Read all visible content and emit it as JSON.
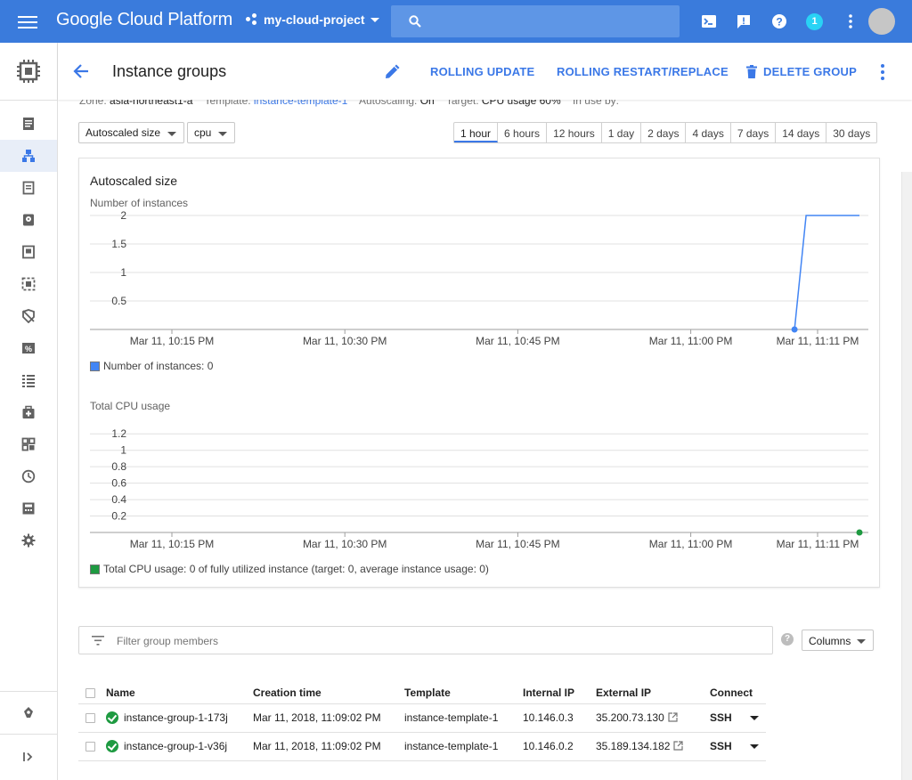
{
  "topbar": {
    "brand": "Google Cloud Platform",
    "project": "my-cloud-project",
    "notification_count": "1",
    "icons": [
      "menu-icon",
      "search-icon",
      "cloud-shell-icon",
      "feedback-icon",
      "help-icon",
      "more-vert-icon"
    ]
  },
  "sidenav": {
    "icons": [
      "compute-engine-icon",
      "vm-instances-icon",
      "instance-groups-icon",
      "instance-templates-icon",
      "disks-icon",
      "snapshots-icon",
      "images-icon",
      "tpus-icon",
      "committed-use-icon",
      "metadata-icon",
      "health-checks-icon",
      "zones-icon",
      "operations-icon",
      "security-scans-icon",
      "settings-icon",
      "marketplace-icon",
      "collapse-icon"
    ]
  },
  "header": {
    "title": "Instance groups",
    "rolling_update": "ROLLING UPDATE",
    "rolling_restart": "ROLLING RESTART/REPLACE",
    "delete_group": "DELETE GROUP"
  },
  "info_strip": {
    "zone_label": "Zone:",
    "zone_value": "asia-northeast1-a",
    "template_label": "Template:",
    "template_value": "instance-template-1",
    "autoscaling_label": "Autoscaling:",
    "autoscaling_value": "On",
    "target_label": "Target:",
    "target_value": "CPU usage 60%",
    "inuse_label": "In use by:"
  },
  "controls": {
    "metric_select": "Autoscaled size",
    "resource_select": "cpu",
    "time_ranges": [
      "1 hour",
      "6 hours",
      "12 hours",
      "1 day",
      "2 days",
      "4 days",
      "7 days",
      "14 days",
      "30 days"
    ],
    "selected_range": "1 hour"
  },
  "card": {
    "title": "Autoscaled size"
  },
  "colors": {
    "topbar": "#3a7bdc",
    "accent": "#3b78e7",
    "series_instances": "#4285f4",
    "series_cpu": "#1e9a41"
  },
  "chart_data": [
    {
      "type": "line",
      "title": "Number of instances",
      "x_ticks": [
        "Mar 11, 10:15 PM",
        "Mar 11, 10:30 PM",
        "Mar 11, 10:45 PM",
        "Mar 11, 11:00 PM",
        "Mar 11, 11:11 PM"
      ],
      "y_ticks": [
        "2",
        "1.5",
        "1",
        "0.5"
      ],
      "ylim": [
        0,
        2
      ],
      "grid": true,
      "legend": "bottom-left",
      "series": [
        {
          "name": "Number of instances: 0",
          "x": [
            "Mar 11, 11:09 PM",
            "Mar 11, 11:10 PM",
            "Mar 11, 11:11 PM"
          ],
          "values": [
            0,
            2,
            2
          ]
        }
      ]
    },
    {
      "type": "line",
      "title": "Total CPU usage",
      "x_ticks": [
        "Mar 11, 10:15 PM",
        "Mar 11, 10:30 PM",
        "Mar 11, 10:45 PM",
        "Mar 11, 11:00 PM",
        "Mar 11, 11:11 PM"
      ],
      "y_ticks": [
        "1.2",
        "1",
        "0.8",
        "0.6",
        "0.4",
        "0.2"
      ],
      "ylim": [
        0,
        1.3
      ],
      "grid": true,
      "legend": "bottom-left",
      "series": [
        {
          "name": "Total CPU usage: 0 of fully utilized instance (target: 0, average instance usage: 0)",
          "x": [
            "Mar 11, 11:11 PM"
          ],
          "values": [
            0
          ]
        }
      ]
    }
  ],
  "members": {
    "filter_placeholder": "Filter group members",
    "columns_button": "Columns",
    "help": "?",
    "headers": {
      "name": "Name",
      "creation_time": "Creation time",
      "template": "Template",
      "internal_ip": "Internal IP",
      "external_ip": "External IP",
      "connect": "Connect"
    },
    "rows": [
      {
        "name": "instance-group-1-173j",
        "creation_time": "Mar 11, 2018, 11:09:02 PM",
        "template": "instance-template-1",
        "internal_ip": "10.146.0.3",
        "external_ip": "35.200.73.130",
        "connect": "SSH"
      },
      {
        "name": "instance-group-1-v36j",
        "creation_time": "Mar 11, 2018, 11:09:02 PM",
        "template": "instance-template-1",
        "internal_ip": "10.146.0.2",
        "external_ip": "35.189.134.182",
        "connect": "SSH"
      }
    ]
  }
}
